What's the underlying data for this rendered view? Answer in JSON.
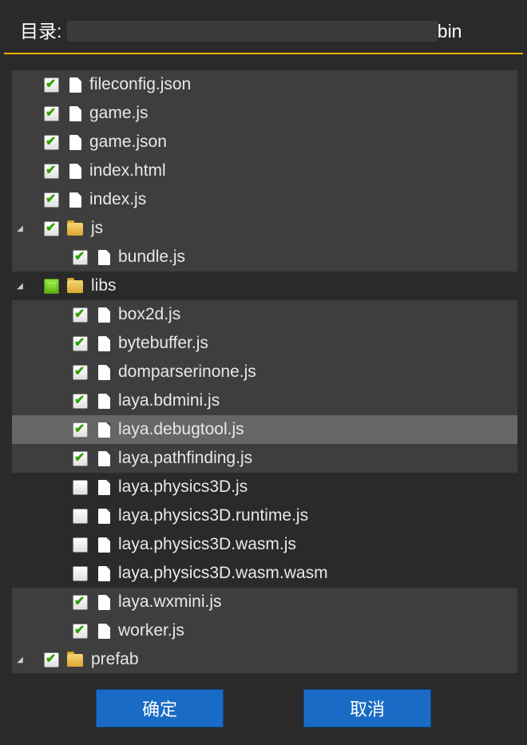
{
  "header": {
    "label_prefix": "目录: ",
    "path_visible_suffix": "bin"
  },
  "tree": [
    {
      "depth": 0,
      "exp": "",
      "check": "checked",
      "type": "file",
      "name": "fileconfig.json",
      "alt": true
    },
    {
      "depth": 0,
      "exp": "",
      "check": "checked",
      "type": "file",
      "name": "game.js",
      "alt": true
    },
    {
      "depth": 0,
      "exp": "",
      "check": "checked",
      "type": "file",
      "name": "game.json",
      "alt": true
    },
    {
      "depth": 0,
      "exp": "",
      "check": "checked",
      "type": "file",
      "name": "index.html",
      "alt": true
    },
    {
      "depth": 0,
      "exp": "",
      "check": "checked",
      "type": "file",
      "name": "index.js",
      "alt": true
    },
    {
      "depth": 0,
      "exp": "◢",
      "check": "checked",
      "type": "folder",
      "name": "js",
      "alt": true
    },
    {
      "depth": 1,
      "exp": "",
      "check": "checked",
      "type": "file",
      "name": "bundle.js",
      "alt": true
    },
    {
      "depth": 0,
      "exp": "◢",
      "check": "partial",
      "type": "folder",
      "name": "libs",
      "alt": false
    },
    {
      "depth": 1,
      "exp": "",
      "check": "checked",
      "type": "file",
      "name": "box2d.js",
      "alt": true
    },
    {
      "depth": 1,
      "exp": "",
      "check": "checked",
      "type": "file",
      "name": "bytebuffer.js",
      "alt": true
    },
    {
      "depth": 1,
      "exp": "",
      "check": "checked",
      "type": "file",
      "name": "domparserinone.js",
      "alt": true
    },
    {
      "depth": 1,
      "exp": "",
      "check": "checked",
      "type": "file",
      "name": "laya.bdmini.js",
      "alt": true
    },
    {
      "depth": 1,
      "exp": "",
      "check": "checked",
      "type": "file",
      "name": "laya.debugtool.js",
      "alt": true,
      "hover": true
    },
    {
      "depth": 1,
      "exp": "",
      "check": "checked",
      "type": "file",
      "name": "laya.pathfinding.js",
      "alt": true
    },
    {
      "depth": 1,
      "exp": "",
      "check": "",
      "type": "file",
      "name": "laya.physics3D.js",
      "alt": false
    },
    {
      "depth": 1,
      "exp": "",
      "check": "",
      "type": "file",
      "name": "laya.physics3D.runtime.js",
      "alt": false
    },
    {
      "depth": 1,
      "exp": "",
      "check": "",
      "type": "file",
      "name": "laya.physics3D.wasm.js",
      "alt": false
    },
    {
      "depth": 1,
      "exp": "",
      "check": "",
      "type": "file",
      "name": "laya.physics3D.wasm.wasm",
      "alt": false
    },
    {
      "depth": 1,
      "exp": "",
      "check": "checked",
      "type": "file",
      "name": "laya.wxmini.js",
      "alt": true
    },
    {
      "depth": 1,
      "exp": "",
      "check": "checked",
      "type": "file",
      "name": "worker.js",
      "alt": true
    },
    {
      "depth": 0,
      "exp": "◢",
      "check": "checked",
      "type": "folder",
      "name": "prefab",
      "alt": true
    }
  ],
  "buttons": {
    "ok": "确定",
    "cancel": "取消"
  }
}
